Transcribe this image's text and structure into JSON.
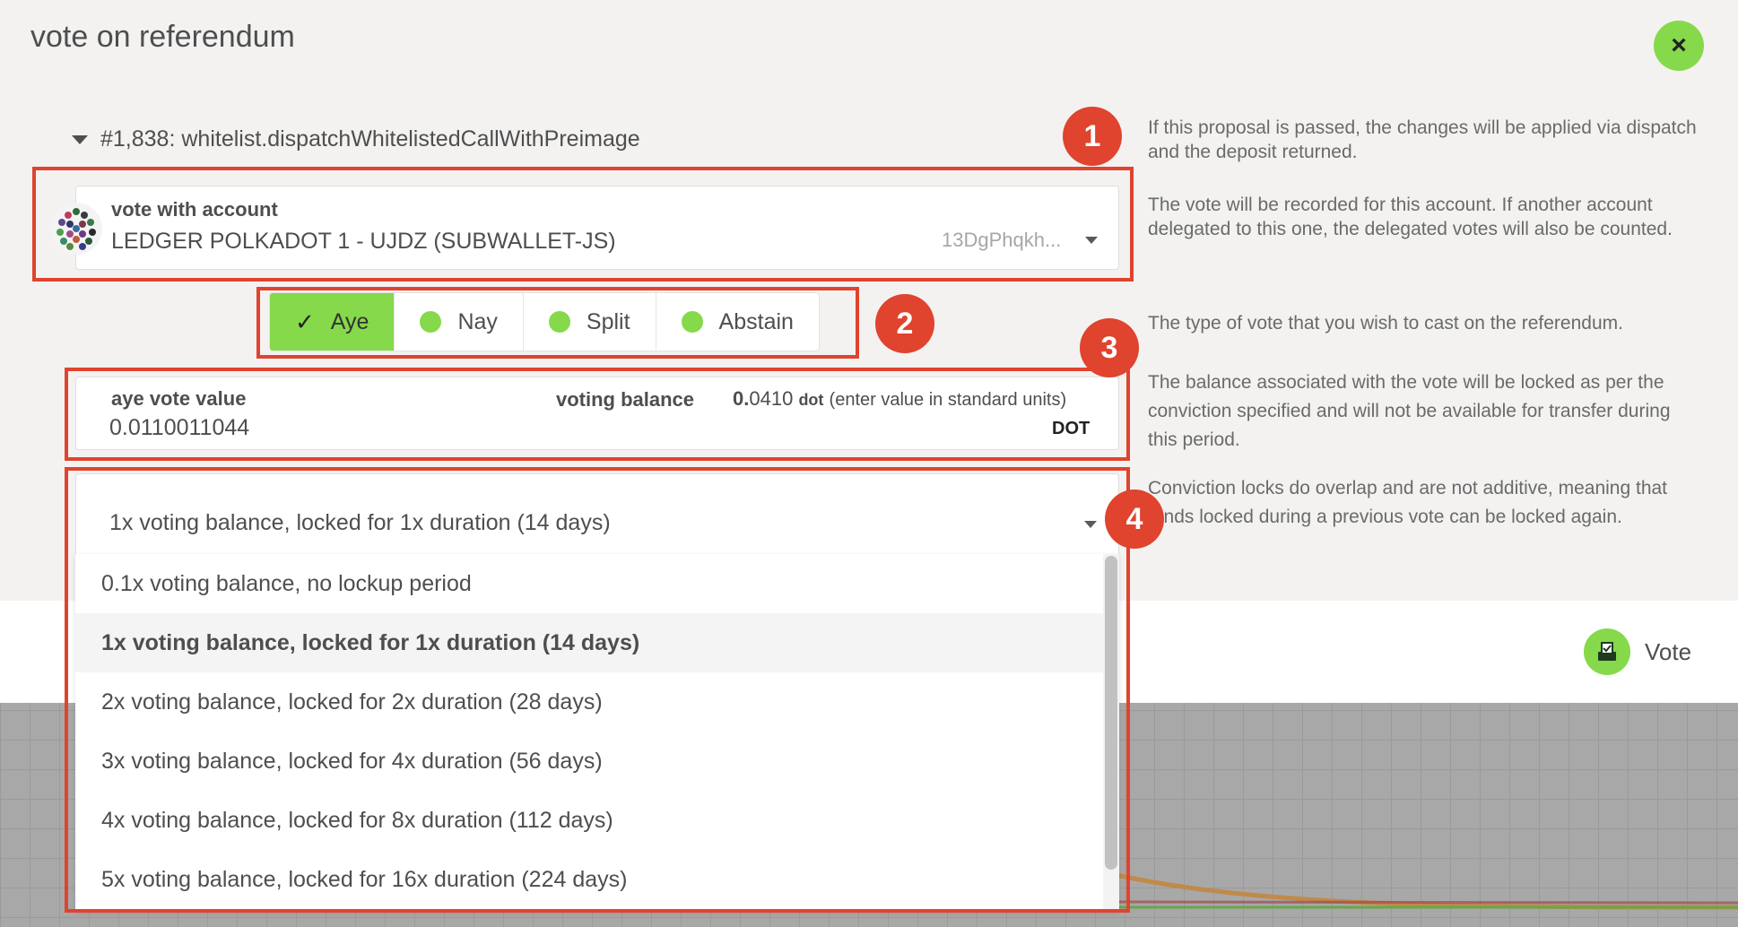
{
  "modal": {
    "title": "vote on referendum",
    "close_icon": "×"
  },
  "proposal": {
    "label": "#1,838: whitelist.dispatchWhitelistedCallWithPreimage"
  },
  "account": {
    "label": "vote with account",
    "name": "LEDGER POLKADOT 1 - UJDZ (SUBWALLET-JS)",
    "address": "13DgPhqkh..."
  },
  "vote_types": {
    "aye": "Aye",
    "nay": "Nay",
    "split": "Split",
    "abstain": "Abstain",
    "selected": "Aye"
  },
  "value": {
    "label": "aye vote value",
    "input": "0.0110011044",
    "balance_label": "voting balance",
    "balance_int": "0.",
    "balance_frac": "0410",
    "balance_unit": "dot",
    "balance_hint": "(enter value in standard units)",
    "unit": "DOT"
  },
  "conviction": {
    "selected": "1x voting balance, locked for 1x duration (14 days)",
    "options": [
      "0.1x voting balance, no lockup period",
      "1x voting balance, locked for 1x duration (14 days)",
      "2x voting balance, locked for 2x duration (28 days)",
      "3x voting balance, locked for 4x duration (56 days)",
      "4x voting balance, locked for 8x duration (112 days)",
      "5x voting balance, locked for 16x duration (224 days)"
    ]
  },
  "annotations": [
    "1",
    "2",
    "3",
    "4"
  ],
  "help": {
    "proposal": "If this proposal is passed, the changes will be applied via dispatch and the deposit returned.",
    "account": "The vote will be recorded for this account. If another account delegated to this one, the delegated votes will also be counted.",
    "vote_type": "The type of vote that you wish to cast on the referendum.",
    "balance": "The balance associated with the vote will be locked as per the conviction specified and will not be available for transfer during this period.",
    "conviction": "Conviction locks do overlap and are not additive, meaning that funds locked during a previous vote can be locked again."
  },
  "actions": {
    "vote": "Vote"
  },
  "colors": {
    "accent": "#86d94a",
    "annotation": "#e0432e"
  }
}
